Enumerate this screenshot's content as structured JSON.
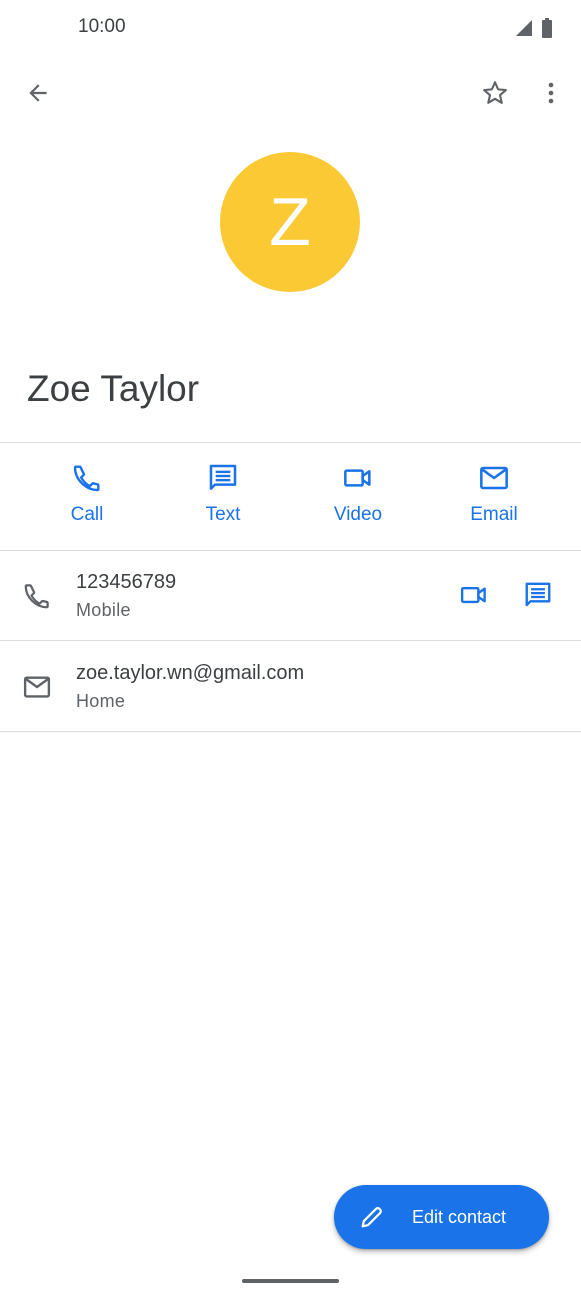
{
  "colors": {
    "accent": "#1a73e8",
    "avatar": "#fbc934",
    "icon_gray": "#5f6368"
  },
  "status_bar": {
    "time": "10:00",
    "icons": [
      "signal-icon",
      "battery-icon"
    ]
  },
  "top_bar": {
    "back_icon": "arrow-back-icon",
    "favorite_icon": "star-outline-icon",
    "more_icon": "more-vert-icon"
  },
  "contact": {
    "initial": "Z",
    "name": "Zoe Taylor"
  },
  "actions": [
    {
      "label": "Call",
      "icon": "phone-icon"
    },
    {
      "label": "Text",
      "icon": "message-icon"
    },
    {
      "label": "Video",
      "icon": "videocam-icon"
    },
    {
      "label": "Email",
      "icon": "email-icon"
    }
  ],
  "details": {
    "phone": {
      "value": "123456789",
      "type": "Mobile"
    },
    "email": {
      "value": "zoe.taylor.wn@gmail.com",
      "type": "Home"
    }
  },
  "fab": {
    "label": "Edit contact",
    "icon": "pencil-icon"
  }
}
